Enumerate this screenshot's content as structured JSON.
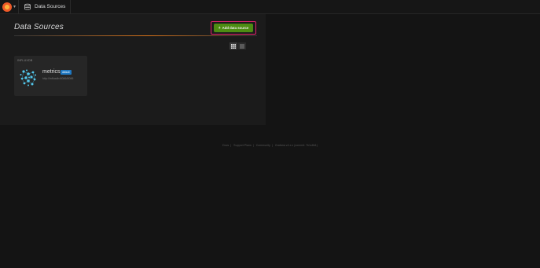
{
  "navbar": {
    "logo_icon": "grafana-logo-icon",
    "caret_icon": "caret-down-icon",
    "breadcrumb_icon": "database-icon",
    "breadcrumb_label": "Data Sources"
  },
  "header": {
    "title": "Data Sources",
    "add_button_label": "Add data source",
    "add_button_icon": "plus-icon",
    "highlight_color": "#e5226d",
    "button_color": "#4d8c12",
    "accent_rule_color": "#eb7b18"
  },
  "view_toggle": {
    "active": "grid",
    "icons": [
      "grid-view-icon",
      "list-view-icon"
    ]
  },
  "datasources": [
    {
      "type": "INFLUXDB",
      "name": "metrics",
      "badge": "default",
      "url": "http://influxdb:8086/8086",
      "logo_icon": "influxdb-logo-icon"
    }
  ],
  "footer": {
    "items": [
      "Docs",
      "Support Plans",
      "Community",
      "Grafana v4.x.x (commit: 7b1c8b1)"
    ]
  }
}
